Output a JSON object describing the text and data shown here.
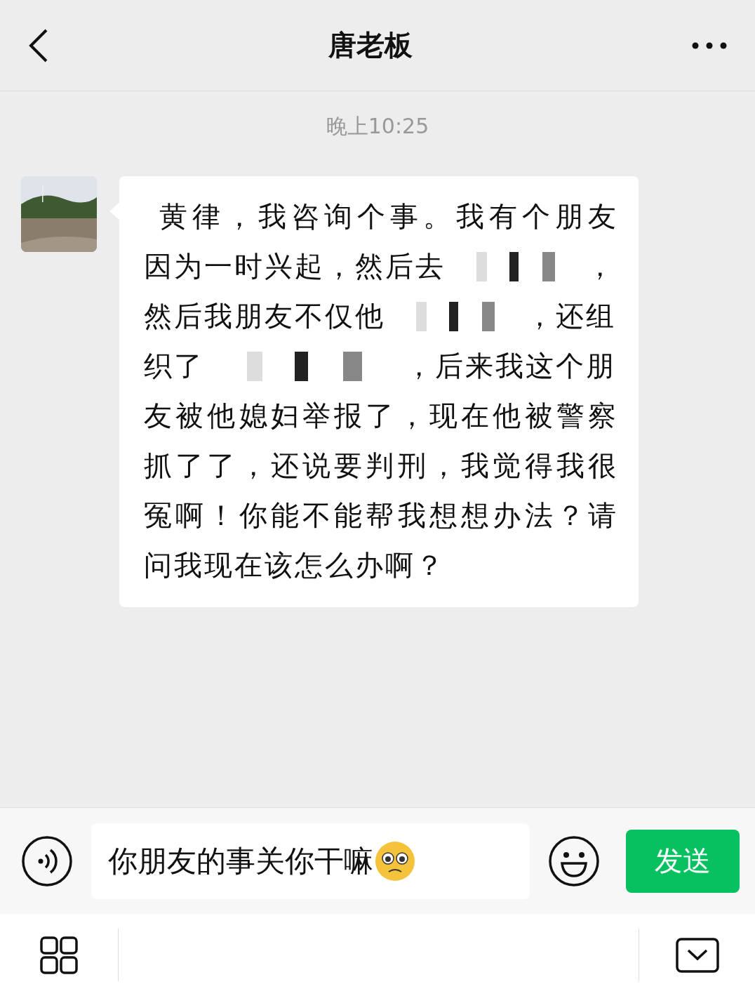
{
  "header": {
    "title": "唐老板"
  },
  "timestamp": "晚上10:25",
  "messages": [
    {
      "lines": [
        [
          {
            "kind": "text",
            "text": "黄律，我咨询个事。我有个朋友"
          }
        ],
        [
          {
            "kind": "text",
            "text": "因为一时兴起，然后去"
          },
          {
            "kind": "redacted"
          },
          {
            "kind": "text",
            "text": "，"
          }
        ],
        [
          {
            "kind": "text",
            "text": "然后我朋友不仅他"
          },
          {
            "kind": "redacted"
          },
          {
            "kind": "text",
            "text": "，还组"
          }
        ],
        [
          {
            "kind": "text",
            "text": "织了"
          },
          {
            "kind": "redacted"
          },
          {
            "kind": "text",
            "text": "，后来我这个朋"
          }
        ],
        [
          {
            "kind": "text",
            "text": "友被他媳妇举报了，现在他被警察"
          }
        ],
        [
          {
            "kind": "text",
            "text": "抓了了，还说要判刑，我觉得我很"
          }
        ],
        [
          {
            "kind": "text",
            "text": "冤啊！你能不能帮我想想办法？请"
          }
        ],
        [
          {
            "kind": "text",
            "text": "问我现在该怎么办啊？"
          }
        ]
      ]
    }
  ],
  "composer": {
    "value": "你朋友的事关你干嘛",
    "send": "发送"
  }
}
